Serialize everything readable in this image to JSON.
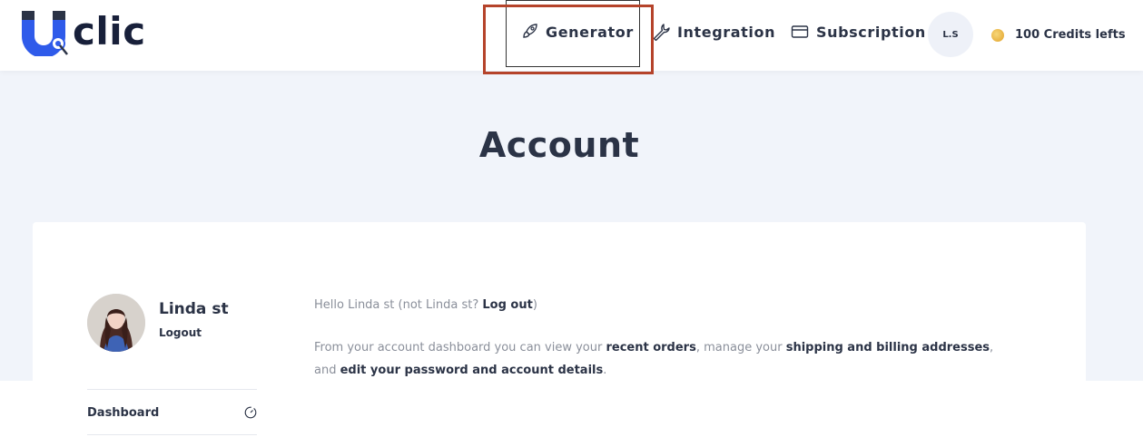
{
  "brand": {
    "logo_letter": "U",
    "logo_text": "clic"
  },
  "nav": {
    "generator": "Generator",
    "integration": "Integration",
    "subscription": "Subscription"
  },
  "user_badge": "L.S",
  "credits": "100 Credits lefts",
  "page": {
    "title": "Account"
  },
  "profile": {
    "name": "Linda st",
    "logout": "Logout"
  },
  "sidebar": {
    "items": [
      {
        "label": "Dashboard"
      }
    ]
  },
  "content": {
    "greeting_prefix": "Hello Linda st (not Linda st? ",
    "greeting_link": "Log out",
    "greeting_suffix": ")",
    "intro_1": "From your account dashboard you can view your ",
    "link_orders": "recent orders",
    "intro_2": ", manage your ",
    "link_addresses": "shipping and billing addresses",
    "intro_3": ",",
    "intro_4": "and ",
    "link_password": "edit your password and account details",
    "intro_5": "."
  },
  "colors": {
    "brand_blue": "#2f5bea",
    "highlight": "#b5432a",
    "text_dark": "#2b3346",
    "text_muted": "#8a8f9a",
    "page_bg": "#f1f4fa"
  }
}
